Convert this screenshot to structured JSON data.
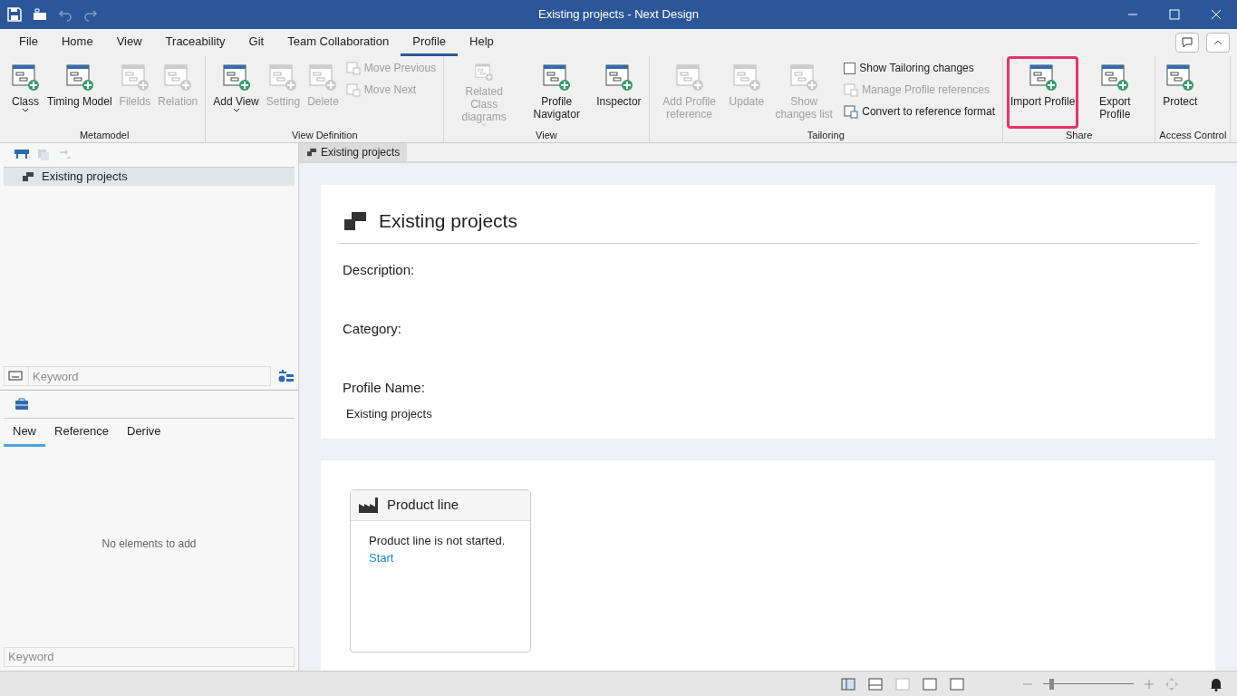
{
  "window": {
    "title": "Existing projects - Next Design"
  },
  "menu_tabs": [
    {
      "label": "File",
      "selected": false
    },
    {
      "label": "Home",
      "selected": false
    },
    {
      "label": "View",
      "selected": false
    },
    {
      "label": "Traceability",
      "selected": false
    },
    {
      "label": "Git",
      "selected": false
    },
    {
      "label": "Team Collaboration",
      "selected": false
    },
    {
      "label": "Profile",
      "selected": true
    },
    {
      "label": "Help",
      "selected": false
    }
  ],
  "ribbon_groups": [
    {
      "label": "Metamodel",
      "items": [
        {
          "kind": "large",
          "label": "Class",
          "dropdown": true,
          "disabled": false,
          "highlighted": false
        },
        {
          "kind": "large",
          "label": "Timing Model",
          "dropdown": false,
          "disabled": false,
          "highlighted": false
        },
        {
          "kind": "large",
          "label": "Filelds",
          "dropdown": false,
          "disabled": true,
          "highlighted": false
        },
        {
          "kind": "large",
          "label": "Relation",
          "dropdown": false,
          "disabled": true,
          "highlighted": false
        }
      ]
    },
    {
      "label": "View Definition",
      "items": [
        {
          "kind": "large",
          "label": "Add View",
          "dropdown": true,
          "disabled": false,
          "highlighted": false
        },
        {
          "kind": "large",
          "label": "Setting",
          "dropdown": false,
          "disabled": true,
          "highlighted": false
        },
        {
          "kind": "large",
          "label": "Delete",
          "dropdown": false,
          "disabled": true,
          "highlighted": false
        },
        {
          "kind": "stack",
          "items": [
            {
              "kind": "small",
              "label": "Move Previous",
              "disabled": true
            },
            {
              "kind": "small",
              "label": "Move Next",
              "disabled": true
            }
          ]
        }
      ]
    },
    {
      "label": "View",
      "items": [
        {
          "kind": "large",
          "label": "Related Class diagrams",
          "dropdown": true,
          "disabled": true,
          "highlighted": false
        },
        {
          "kind": "large",
          "label": "Profile Navigator",
          "dropdown": false,
          "disabled": false,
          "highlighted": false
        },
        {
          "kind": "large",
          "label": "Inspector",
          "dropdown": false,
          "disabled": false,
          "highlighted": false
        }
      ]
    },
    {
      "label": "Tailoring",
      "items": [
        {
          "kind": "large",
          "label": "Add Profile reference",
          "dropdown": false,
          "disabled": true,
          "highlighted": false
        },
        {
          "kind": "large",
          "label": "Update",
          "dropdown": false,
          "disabled": true,
          "highlighted": false
        },
        {
          "kind": "large",
          "label": "Show changes list",
          "dropdown": false,
          "disabled": true,
          "highlighted": false
        },
        {
          "kind": "stack",
          "items": [
            {
              "kind": "checkbox",
              "label": "Show Tailoring changes",
              "checked": false
            },
            {
              "kind": "small",
              "label": "Manage Profile references",
              "disabled": true
            },
            {
              "kind": "small",
              "label": "Convert to reference format",
              "disabled": false
            }
          ]
        }
      ]
    },
    {
      "label": "Share",
      "items": [
        {
          "kind": "large",
          "label": "Import Profile",
          "dropdown": false,
          "disabled": false,
          "highlighted": true
        },
        {
          "kind": "large",
          "label": "Export Profile",
          "dropdown": false,
          "disabled": false,
          "highlighted": false
        }
      ]
    },
    {
      "label": "Access Control",
      "items": [
        {
          "kind": "large",
          "label": "Protect",
          "dropdown": false,
          "disabled": false,
          "highlighted": false
        }
      ]
    }
  ],
  "tree": {
    "items": [
      {
        "label": "Existing projects",
        "selected": true
      }
    ]
  },
  "search": {
    "placeholder": "Keyword"
  },
  "palette_tabs": [
    {
      "label": "New",
      "selected": true
    },
    {
      "label": "Reference",
      "selected": false
    },
    {
      "label": "Derive",
      "selected": false
    }
  ],
  "palette": {
    "empty_text": "No elements to add",
    "search_placeholder": "Keyword"
  },
  "document_tab": {
    "label": "Existing projects"
  },
  "profile": {
    "title": "Existing projects",
    "fields": [
      {
        "label": "Description:"
      },
      {
        "label": "Category:"
      },
      {
        "label": "Profile Name:",
        "value": "Existing projects"
      }
    ]
  },
  "product_line": {
    "title": "Product line",
    "message": "Product line is not started.",
    "link": "Start"
  },
  "status_bar": {
    "zoom": {
      "level": 0.07
    }
  }
}
